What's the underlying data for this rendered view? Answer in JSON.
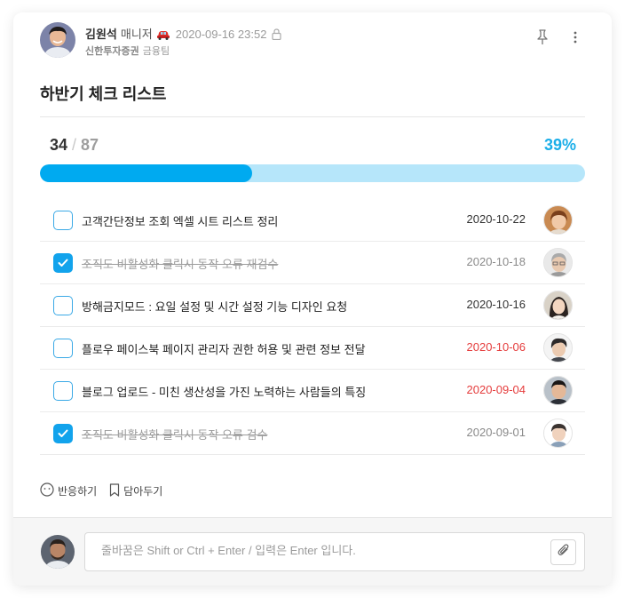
{
  "post": {
    "author_name": "김원석",
    "author_role": "매니저",
    "date": "2020-09-16 23:52",
    "company": "신한투자증권",
    "team": "금융팀",
    "icons": {
      "vehicle": "car-icon",
      "privacy": "lock-icon",
      "pin": "pin-icon",
      "more": "more-vertical-icon"
    }
  },
  "checklist": {
    "title": "하반기 체크 리스트",
    "done_count": "34",
    "separator": "/",
    "total_count": "87",
    "percent_label": "39%",
    "progress": 0.39,
    "accent_color": "#00aaf0",
    "track_color": "#b6e6fa",
    "items": [
      {
        "label": "고객간단정보 조회 엑셀 시트 리스트 정리",
        "date": "2020-10-22",
        "checked": false,
        "overdue": false
      },
      {
        "label": "조직도 비활성화 클릭시 동작 오류 재검수",
        "date": "2020-10-18",
        "checked": true,
        "overdue": false
      },
      {
        "label": "방해금지모드 : 요일 설정 및 시간 설정 기능 디자인 요청",
        "date": "2020-10-16",
        "checked": false,
        "overdue": false
      },
      {
        "label": "플로우 페이스북 페이지 관리자 권한 허용 및 관련 정보 전달",
        "date": "2020-10-06",
        "checked": false,
        "overdue": true
      },
      {
        "label": "블로그 업로드 - 미친 생산성을 가진 노력하는 사람들의 특징",
        "date": "2020-09-04",
        "checked": false,
        "overdue": true
      },
      {
        "label": "조직도 비활성화 클릭시 동작 오류 검수",
        "date": "2020-09-01",
        "checked": true,
        "overdue": false
      }
    ],
    "overdue_color": "#e53c3c"
  },
  "actions": {
    "react_label": "반응하기",
    "bookmark_label": "담아두기"
  },
  "comment": {
    "placeholder": "줄바꿈은 Shift or Ctrl + Enter / 입력은 Enter 입니다.",
    "attach_icon": "paperclip-icon"
  }
}
